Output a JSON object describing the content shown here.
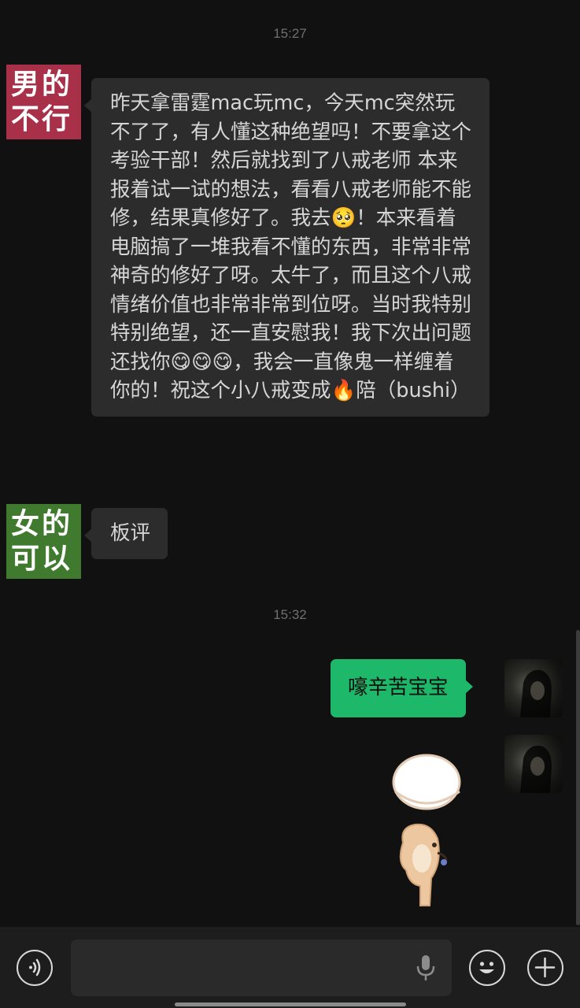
{
  "conversation": {
    "timestamps": [
      "15:27",
      "15:32"
    ],
    "messages": [
      {
        "sender_overlay": "男的\n不行",
        "overlay_color": "#a83048",
        "text": "昨天拿雷霆mac玩mc，今天mc突然玩不了了，有人懂这种绝望吗！不要拿这个考验干部！然后就找到了八戒老师 本来报着试一试的想法，看看八戒老师能不能修，结果真修好了。我去🥺！本来看着电脑搞了一堆我看不懂的东西，非常非常神奇的修好了呀。太牛了，而且这个八戒情绪价值也非常非常到位呀。当时我特别特别绝望，还一直安慰我！我下次出问题还找你😋😋😋，我会一直像鬼一样缠着你的！祝这个小八戒变成🔥陪（bushi）"
      },
      {
        "sender_overlay": "女的\n可以",
        "overlay_color": "#3f7a2e",
        "text": "板评"
      },
      {
        "text": "嚎辛苦宝宝",
        "outgoing": true
      }
    ]
  },
  "colors": {
    "background": "#111111",
    "incoming_bubble": "#2c2c2c",
    "outgoing_bubble": "#1eb86a",
    "input_bar": "#1d1d1d"
  },
  "icons": {
    "voice": "voice-icon",
    "mic": "mic-icon",
    "emoji": "emoji-icon",
    "add": "plus-icon"
  }
}
